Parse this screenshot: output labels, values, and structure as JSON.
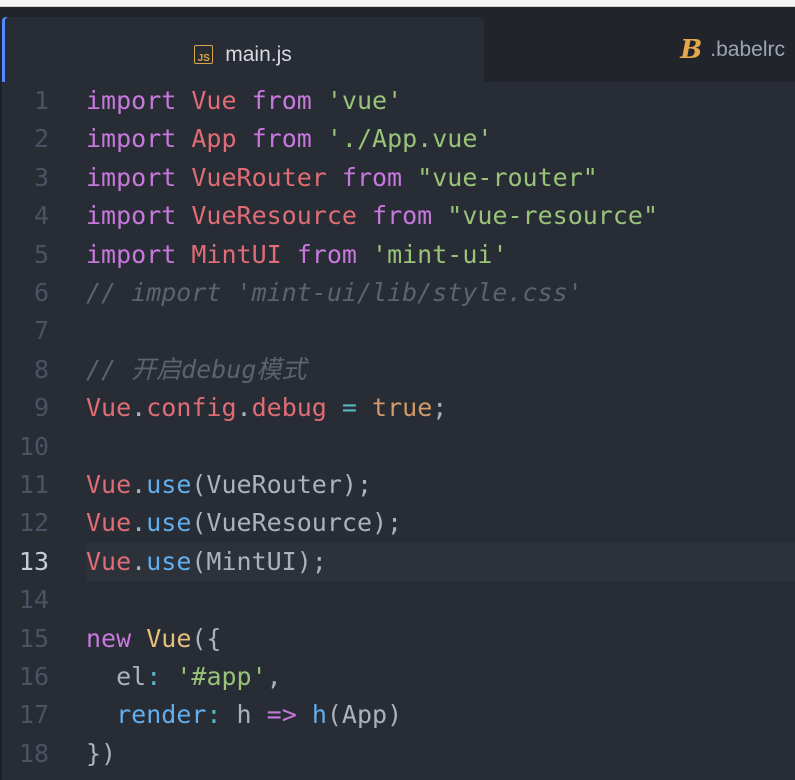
{
  "tabs": [
    {
      "label": "main.js",
      "icon": "js-file-icon",
      "icon_text": "JS",
      "active": true
    },
    {
      "label": ".babelrc",
      "icon": "babel-icon",
      "icon_text": "B",
      "active": false
    }
  ],
  "editor": {
    "current_line": 13,
    "lines": [
      {
        "n": "1",
        "t": [
          [
            "import",
            "kw"
          ],
          [
            " ",
            "txt"
          ],
          [
            "Vue",
            "var"
          ],
          [
            " ",
            "txt"
          ],
          [
            "from",
            "kw"
          ],
          [
            " ",
            "txt"
          ],
          [
            "'vue'",
            "str"
          ]
        ]
      },
      {
        "n": "2",
        "t": [
          [
            "import",
            "kw"
          ],
          [
            " ",
            "txt"
          ],
          [
            "App",
            "var"
          ],
          [
            " ",
            "txt"
          ],
          [
            "from",
            "kw"
          ],
          [
            " ",
            "txt"
          ],
          [
            "'./App.vue'",
            "str"
          ]
        ]
      },
      {
        "n": "3",
        "t": [
          [
            "import",
            "kw"
          ],
          [
            " ",
            "txt"
          ],
          [
            "VueRouter",
            "var"
          ],
          [
            " ",
            "txt"
          ],
          [
            "from",
            "kw"
          ],
          [
            " ",
            "txt"
          ],
          [
            "\"vue-router\"",
            "str"
          ]
        ]
      },
      {
        "n": "4",
        "t": [
          [
            "import",
            "kw"
          ],
          [
            " ",
            "txt"
          ],
          [
            "VueResource",
            "var"
          ],
          [
            " ",
            "txt"
          ],
          [
            "from",
            "kw"
          ],
          [
            " ",
            "txt"
          ],
          [
            "\"vue-resource\"",
            "str"
          ]
        ]
      },
      {
        "n": "5",
        "t": [
          [
            "import",
            "kw"
          ],
          [
            " ",
            "txt"
          ],
          [
            "MintUI",
            "var"
          ],
          [
            " ",
            "txt"
          ],
          [
            "from",
            "kw"
          ],
          [
            " ",
            "txt"
          ],
          [
            "'mint-ui'",
            "str"
          ]
        ]
      },
      {
        "n": "6",
        "t": [
          [
            "// import 'mint-ui/lib/style.css'",
            "com"
          ]
        ]
      },
      {
        "n": "7",
        "t": []
      },
      {
        "n": "8",
        "t": [
          [
            "// 开启debug模式",
            "com"
          ]
        ]
      },
      {
        "n": "9",
        "t": [
          [
            "Vue",
            "var"
          ],
          [
            ".",
            "txt"
          ],
          [
            "config",
            "var"
          ],
          [
            ".",
            "txt"
          ],
          [
            "debug",
            "var"
          ],
          [
            " ",
            "txt"
          ],
          [
            "=",
            "op"
          ],
          [
            " ",
            "txt"
          ],
          [
            "true",
            "num-lit"
          ],
          [
            ";",
            "txt"
          ]
        ]
      },
      {
        "n": "10",
        "t": []
      },
      {
        "n": "11",
        "t": [
          [
            "Vue",
            "var"
          ],
          [
            ".",
            "txt"
          ],
          [
            "use",
            "fn"
          ],
          [
            "(VueRouter);",
            "txt"
          ]
        ]
      },
      {
        "n": "12",
        "t": [
          [
            "Vue",
            "var"
          ],
          [
            ".",
            "txt"
          ],
          [
            "use",
            "fn"
          ],
          [
            "(VueResource);",
            "txt"
          ]
        ]
      },
      {
        "n": "13",
        "t": [
          [
            "Vue",
            "var"
          ],
          [
            ".",
            "txt"
          ],
          [
            "use",
            "fn"
          ],
          [
            "(MintUI);",
            "txt"
          ]
        ]
      },
      {
        "n": "14",
        "t": []
      },
      {
        "n": "15",
        "t": [
          [
            "new",
            "kw"
          ],
          [
            " ",
            "txt"
          ],
          [
            "Vue",
            "cls"
          ],
          [
            "({",
            "txt"
          ]
        ]
      },
      {
        "n": "16",
        "t": [
          [
            "  el",
            "txt"
          ],
          [
            ":",
            "op"
          ],
          [
            " ",
            "txt"
          ],
          [
            "'#app'",
            "str"
          ],
          [
            ",",
            "txt"
          ]
        ]
      },
      {
        "n": "17",
        "t": [
          [
            "  ",
            "txt"
          ],
          [
            "render",
            "fn"
          ],
          [
            ":",
            "op"
          ],
          [
            " h ",
            "txt"
          ],
          [
            "=>",
            "kw"
          ],
          [
            " ",
            "txt"
          ],
          [
            "h",
            "fn"
          ],
          [
            "(App)",
            "txt"
          ]
        ]
      },
      {
        "n": "18",
        "t": [
          [
            "})",
            "txt"
          ]
        ]
      }
    ]
  }
}
